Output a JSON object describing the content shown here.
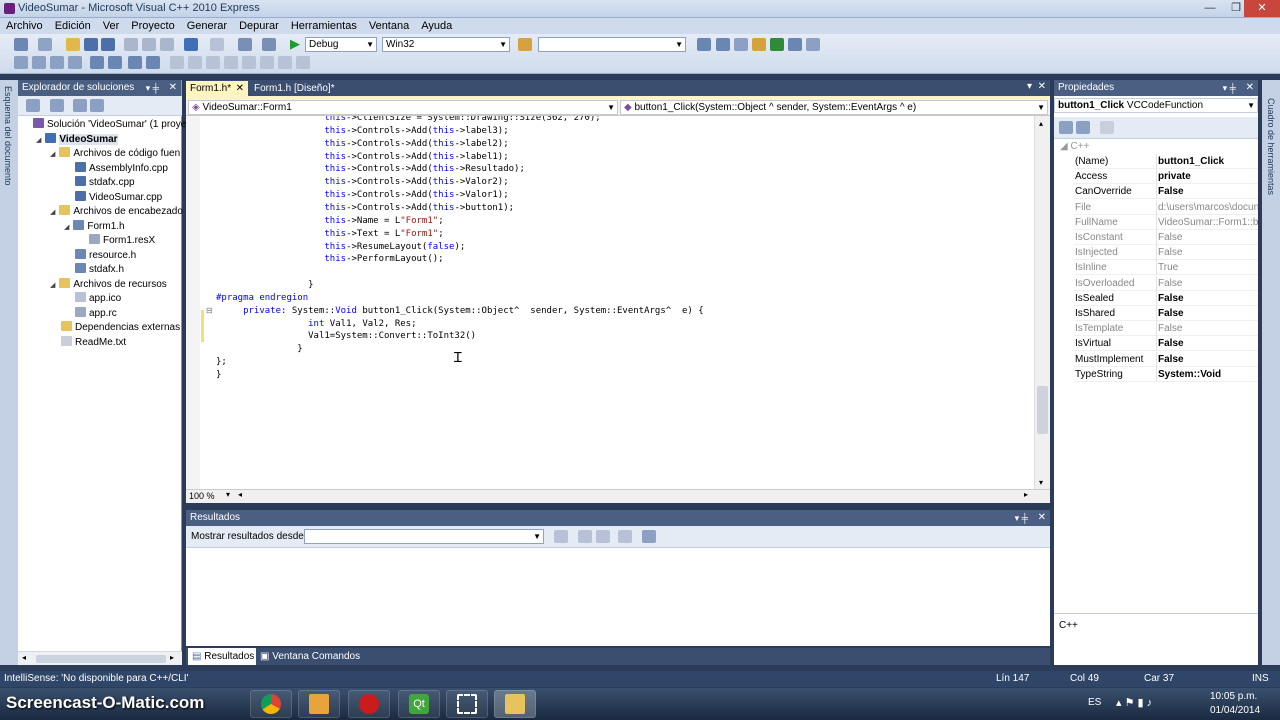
{
  "window": {
    "title": "VideoSumar - Microsoft Visual C++ 2010 Express"
  },
  "menu": [
    "Archivo",
    "Edición",
    "Ver",
    "Proyecto",
    "Generar",
    "Depurar",
    "Herramientas",
    "Ventana",
    "Ayuda"
  ],
  "toolbar": {
    "config_value": "Debug",
    "platform_value": "Win32",
    "find_value": ""
  },
  "solution_explorer": {
    "title": "Explorador de soluciones",
    "items": [
      {
        "label": "Solución 'VideoSumar' (1 proye",
        "indent": 0,
        "expand": "",
        "icon": "solution-icon",
        "bold": false
      },
      {
        "label": "VideoSumar",
        "indent": 1,
        "expand": "◢",
        "icon": "project-icon",
        "bold": true
      },
      {
        "label": "Archivos de código fuen",
        "indent": 2,
        "expand": "◢",
        "icon": "folder-icon",
        "bold": false
      },
      {
        "label": "AssemblyInfo.cpp",
        "indent": 3,
        "expand": "",
        "icon": "cpp-file-icon",
        "bold": false
      },
      {
        "label": "stdafx.cpp",
        "indent": 3,
        "expand": "",
        "icon": "cpp-file-icon",
        "bold": false
      },
      {
        "label": "VideoSumar.cpp",
        "indent": 3,
        "expand": "",
        "icon": "cpp-file-icon",
        "bold": false
      },
      {
        "label": "Archivos de encabezado",
        "indent": 2,
        "expand": "◢",
        "icon": "folder-icon",
        "bold": false
      },
      {
        "label": "Form1.h",
        "indent": 3,
        "expand": "◢",
        "icon": "form-icon",
        "bold": false
      },
      {
        "label": "Form1.resX",
        "indent": 4,
        "expand": "",
        "icon": "resx-file-icon",
        "bold": false
      },
      {
        "label": "resource.h",
        "indent": 3,
        "expand": "",
        "icon": "h-file-icon",
        "bold": false
      },
      {
        "label": "stdafx.h",
        "indent": 3,
        "expand": "",
        "icon": "h-file-icon",
        "bold": false
      },
      {
        "label": "Archivos de recursos",
        "indent": 2,
        "expand": "◢",
        "icon": "folder-icon",
        "bold": false
      },
      {
        "label": "app.ico",
        "indent": 3,
        "expand": "",
        "icon": "ico-file-icon",
        "bold": false
      },
      {
        "label": "app.rc",
        "indent": 3,
        "expand": "",
        "icon": "rc-file-icon",
        "bold": false
      },
      {
        "label": "Dependencias externas",
        "indent": 2,
        "expand": "",
        "icon": "folder-icon",
        "bold": false
      },
      {
        "label": "ReadMe.txt",
        "indent": 2,
        "expand": "",
        "icon": "txt-file-icon",
        "bold": false
      }
    ]
  },
  "left_strip": {
    "label": "Esquema del documento"
  },
  "right_strip": {
    "label": "Cuadro de herramientas"
  },
  "editor_tabs": [
    {
      "label": "Form1.h*",
      "active": true
    },
    {
      "label": "Form1.h [Diseño]*",
      "active": false
    }
  ],
  "editor_nav": {
    "scope": "VideoSumar::Form1",
    "member": "button1_Click(System::Object ^ sender, System::EventArgs ^ e)"
  },
  "code_lines": [
    {
      "indent": "                    ",
      "tokens": [
        [
          "this",
          "kw"
        ],
        [
          "->ClientSize = System::Drawing::Size(362, 270);",
          ""
        ]
      ]
    },
    {
      "indent": "                    ",
      "tokens": [
        [
          "this",
          "kw"
        ],
        [
          "->Controls->Add(",
          ""
        ],
        [
          "this",
          "kw"
        ],
        [
          "->label3);",
          ""
        ]
      ]
    },
    {
      "indent": "                    ",
      "tokens": [
        [
          "this",
          "kw"
        ],
        [
          "->Controls->Add(",
          ""
        ],
        [
          "this",
          "kw"
        ],
        [
          "->label2);",
          ""
        ]
      ]
    },
    {
      "indent": "                    ",
      "tokens": [
        [
          "this",
          "kw"
        ],
        [
          "->Controls->Add(",
          ""
        ],
        [
          "this",
          "kw"
        ],
        [
          "->label1);",
          ""
        ]
      ]
    },
    {
      "indent": "                    ",
      "tokens": [
        [
          "this",
          "kw"
        ],
        [
          "->Controls->Add(",
          ""
        ],
        [
          "this",
          "kw"
        ],
        [
          "->Resultado);",
          ""
        ]
      ]
    },
    {
      "indent": "                    ",
      "tokens": [
        [
          "this",
          "kw"
        ],
        [
          "->Controls->Add(",
          ""
        ],
        [
          "this",
          "kw"
        ],
        [
          "->Valor2);",
          ""
        ]
      ]
    },
    {
      "indent": "                    ",
      "tokens": [
        [
          "this",
          "kw"
        ],
        [
          "->Controls->Add(",
          ""
        ],
        [
          "this",
          "kw"
        ],
        [
          "->Valor1);",
          ""
        ]
      ]
    },
    {
      "indent": "                    ",
      "tokens": [
        [
          "this",
          "kw"
        ],
        [
          "->Controls->Add(",
          ""
        ],
        [
          "this",
          "kw"
        ],
        [
          "->button1);",
          ""
        ]
      ]
    },
    {
      "indent": "                    ",
      "tokens": [
        [
          "this",
          "kw"
        ],
        [
          "->Name = L",
          ""
        ],
        [
          "\"Form1\"",
          "str"
        ],
        [
          ";",
          ""
        ]
      ]
    },
    {
      "indent": "                    ",
      "tokens": [
        [
          "this",
          "kw"
        ],
        [
          "->Text = L",
          ""
        ],
        [
          "\"Form1\"",
          "str"
        ],
        [
          ";",
          ""
        ]
      ]
    },
    {
      "indent": "                    ",
      "tokens": [
        [
          "this",
          "kw"
        ],
        [
          "->ResumeLayout(",
          ""
        ],
        [
          "false",
          "kw"
        ],
        [
          ");",
          ""
        ]
      ]
    },
    {
      "indent": "                    ",
      "tokens": [
        [
          "this",
          "kw"
        ],
        [
          "->PerformLayout();",
          ""
        ]
      ]
    },
    {
      "indent": "",
      "tokens": []
    },
    {
      "indent": "                 ",
      "tokens": [
        [
          "}",
          ""
        ]
      ]
    },
    {
      "indent": "",
      "tokens": [
        [
          "#pragma endregion",
          "pp"
        ]
      ]
    },
    {
      "indent": "     ",
      "tokens": [
        [
          "private",
          "kw"
        ],
        [
          ": System::",
          ""
        ],
        [
          "Void",
          "kw"
        ],
        [
          " button1_Click(System::Object^  sender, System::EventArgs^  e) {",
          ""
        ]
      ]
    },
    {
      "indent": "                 ",
      "tokens": [
        [
          "int",
          "kw"
        ],
        [
          " Val1, Val2, Res;",
          ""
        ]
      ]
    },
    {
      "indent": "                 ",
      "tokens": [
        [
          "Val1=System::Convert::ToInt32()",
          ""
        ]
      ]
    },
    {
      "indent": "               ",
      "tokens": [
        [
          "}",
          ""
        ]
      ]
    },
    {
      "indent": "",
      "tokens": [
        [
          "};",
          ""
        ]
      ]
    },
    {
      "indent": "",
      "tokens": [
        [
          "}",
          ""
        ]
      ]
    }
  ],
  "editor_footer": {
    "zoom": "100 %"
  },
  "results": {
    "title": "Resultados",
    "show_from_label": "Mostrar resultados desde:",
    "show_from_value": "",
    "tabs": [
      "Resultados",
      "Ventana Comandos"
    ]
  },
  "properties": {
    "title": "Propiedades",
    "object_name": "button1_Click",
    "object_type": "VCCodeFunction",
    "category": "C++",
    "footer": "C++",
    "rows": [
      {
        "name": "(Name)",
        "value": "button1_Click",
        "dim": false
      },
      {
        "name": "Access",
        "value": "private",
        "dim": false
      },
      {
        "name": "CanOverride",
        "value": "False",
        "dim": false
      },
      {
        "name": "File",
        "value": "d:\\users\\marcos\\docun",
        "dim": true
      },
      {
        "name": "FullName",
        "value": "VideoSumar::Form1::bu",
        "dim": true
      },
      {
        "name": "IsConstant",
        "value": "False",
        "dim": true
      },
      {
        "name": "IsInjected",
        "value": "False",
        "dim": true
      },
      {
        "name": "IsInline",
        "value": "True",
        "dim": true
      },
      {
        "name": "IsOverloaded",
        "value": "False",
        "dim": true
      },
      {
        "name": "IsSealed",
        "value": "False",
        "dim": false
      },
      {
        "name": "IsShared",
        "value": "False",
        "dim": false
      },
      {
        "name": "IsTemplate",
        "value": "False",
        "dim": true
      },
      {
        "name": "IsVirtual",
        "value": "False",
        "dim": false
      },
      {
        "name": "MustImplement",
        "value": "False",
        "dim": false
      },
      {
        "name": "TypeString",
        "value": "System::Void",
        "dim": false
      }
    ]
  },
  "status": {
    "message": "IntelliSense: 'No disponible para C++/CLI'",
    "line": "Lín 147",
    "col": "Col 49",
    "car": "Car 37",
    "mode": "INS"
  },
  "taskbar": {
    "watermark": "Screencast-O-Matic.com",
    "lang": "ES",
    "time": "10:05 p.m.",
    "date": "01/04/2014"
  },
  "colors": {
    "panel_title_bg": "#4b5f82",
    "keyword": "#0000ff",
    "string": "#a31515",
    "status_bg": "#2f4668"
  }
}
